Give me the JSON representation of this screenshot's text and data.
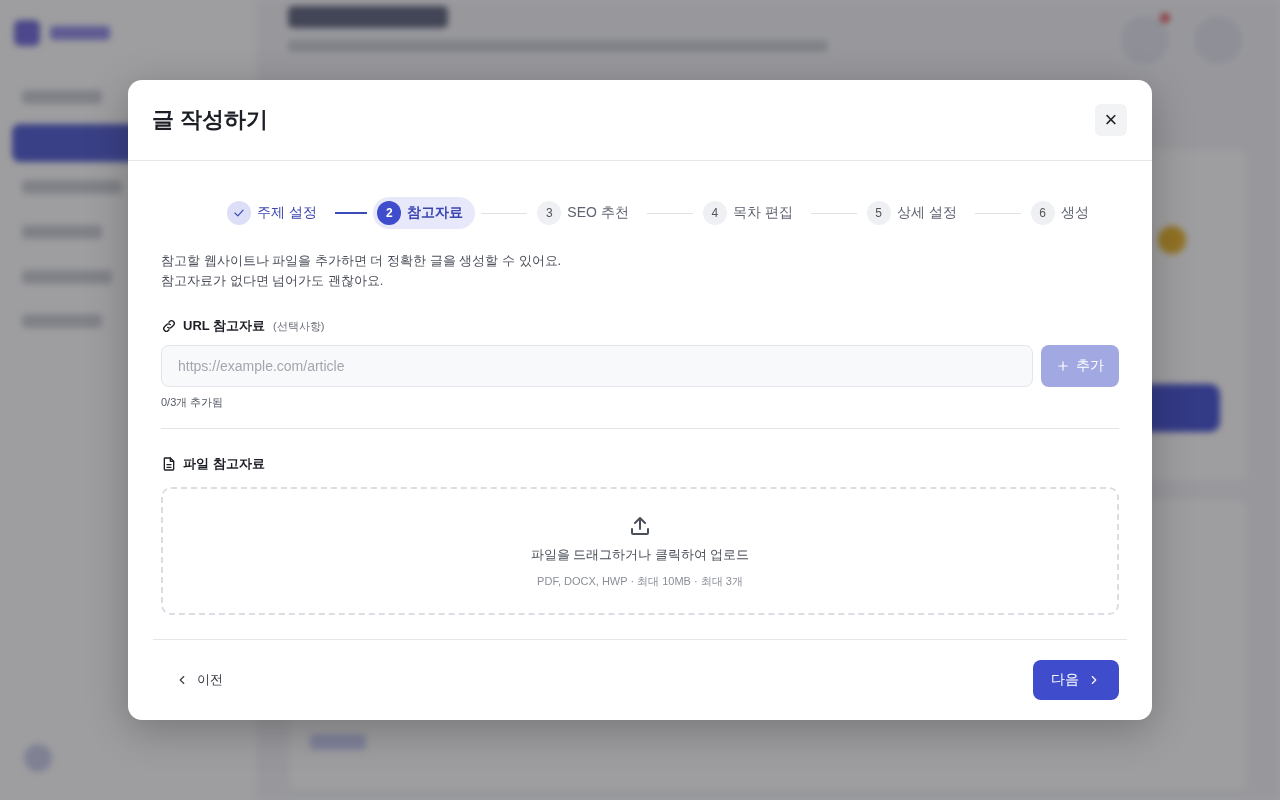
{
  "dialog": {
    "title": "글 작성하기",
    "close_label": "×"
  },
  "steps": [
    {
      "label": "주제 설정",
      "done": true,
      "selected": false
    },
    {
      "number": "2",
      "label": "참고자료",
      "done": false,
      "selected": true
    },
    {
      "number": "3",
      "label": "SEO 추천",
      "done": false,
      "selected": false
    },
    {
      "number": "4",
      "label": "목차 편집",
      "done": false,
      "selected": false
    },
    {
      "number": "5",
      "label": "상세 설정",
      "done": false,
      "selected": false
    },
    {
      "number": "6",
      "label": "생성",
      "done": false,
      "selected": false
    }
  ],
  "intro": [
    "참고할 웹사이트나 파일을 추가하면 더 정확한 글을 생성할 수 있어요.",
    "참고자료가 없다면 넘어가도 괜찮아요."
  ],
  "url_section": {
    "title": "URL 참고자료",
    "hint": "(선택사항)",
    "placeholder": "https://example.com/article",
    "add_button": {
      "label": "추가",
      "disabled": true
    },
    "count": "0/3개 추가됨"
  },
  "file_section": {
    "title": "파일 참고자료",
    "drop_text": "파일을 드래그하거나 클릭하여 업로드",
    "drop_hint": "PDF, DOCX, HWP · 최대 10MB · 최대 3개"
  },
  "footer": {
    "back": "이전",
    "next": "다음"
  }
}
